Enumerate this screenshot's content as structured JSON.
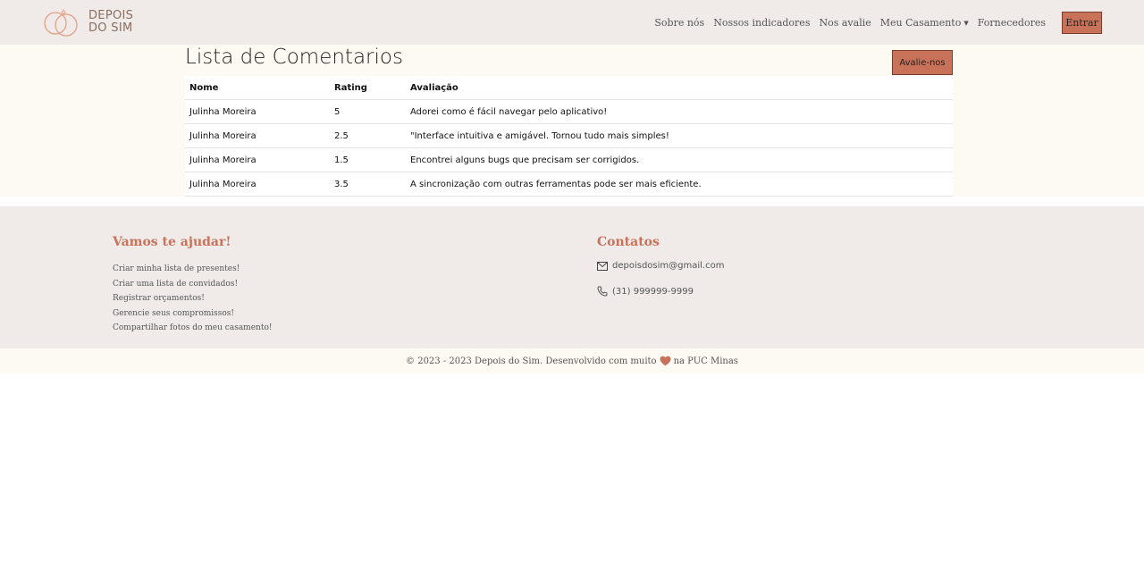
{
  "brand": {
    "line1": "DEPOIS",
    "line2": "DO SIM",
    "accent_color": "#c9725a"
  },
  "nav": {
    "links": [
      "Sobre nós",
      "Nossos indicadores",
      "Nos avalie",
      "Meu Casamento",
      "Fornecedores"
    ],
    "login_label": "Entrar"
  },
  "main": {
    "title": "Lista de Comentarios",
    "rate_button": "Avalie-nos",
    "table": {
      "headers": [
        "Nome",
        "Rating",
        "Avaliação"
      ],
      "rows": [
        [
          "Julinha Moreira",
          "5",
          "Adorei como é fácil navegar pelo aplicativo!"
        ],
        [
          "Julinha Moreira",
          "2.5",
          "\"Interface intuitiva e amigável. Tornou tudo mais simples!"
        ],
        [
          "Julinha Moreira",
          "1.5",
          "Encontrei alguns bugs que precisam ser corrigidos."
        ],
        [
          "Julinha Moreira",
          "3.5",
          "A sincronização com outras ferramentas pode ser mais eficiente."
        ]
      ]
    }
  },
  "footer": {
    "help_title": "Vamos te ajudar!",
    "help_links": [
      "Criar minha lista de presentes!",
      "Criar uma lista de convidados!",
      "Registrar orçamentos!",
      "Gerencie seus compromissos!",
      "Compartilhar fotos do meu casamento!"
    ],
    "contacts_title": "Contatos",
    "email": "depoisdosim@gmail.com",
    "phone": "(31) 999999-9999",
    "copyright_before": "© 2023 - 2023 Depois do Sim. Desenvolvido com muito",
    "copyright_after": "na PUC Minas"
  },
  "icons": {
    "email": "envelope-icon",
    "phone": "phone-icon",
    "heart": "heart-icon",
    "logo": "rings-icon"
  }
}
